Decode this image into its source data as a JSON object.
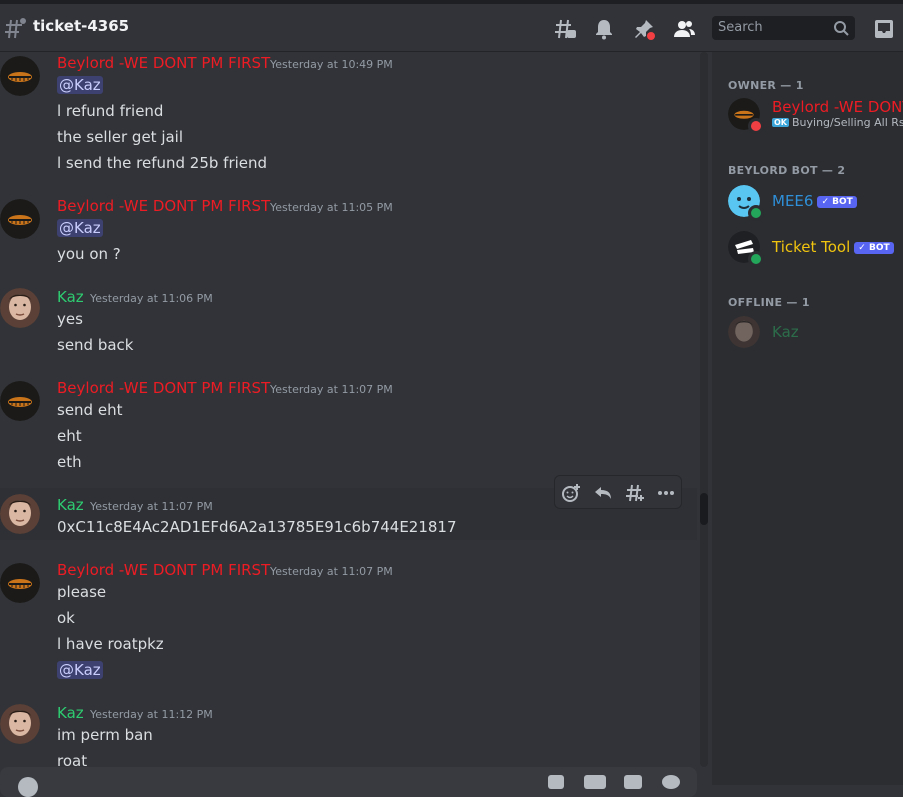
{
  "channel": {
    "name": "ticket-4365"
  },
  "header": {
    "search_placeholder": "Search"
  },
  "messages": [
    {
      "author": "Beylord  -WE DONT PM FIRST",
      "color": "#ed1c24",
      "timestamp": "Yesterday at 10:49 PM",
      "mention": "@Kaz",
      "lines": [
        "l refund friend",
        "the seller get jail",
        "l send the refund 25b friend"
      ]
    },
    {
      "author": "Beylord  -WE DONT PM FIRST",
      "color": "#ed1c24",
      "timestamp": "Yesterday at 11:05 PM",
      "mention": "@Kaz",
      "lines": [
        "you on ?"
      ]
    },
    {
      "author": "Kaz",
      "color": "#2ecc71",
      "timestamp": "Yesterday at 11:06 PM",
      "lines": [
        "yes",
        "send back"
      ]
    },
    {
      "author": "Beylord  -WE DONT PM FIRST",
      "color": "#ed1c24",
      "timestamp": "Yesterday at 11:07 PM",
      "lines": [
        "send eht",
        "eht",
        "eth"
      ]
    },
    {
      "author": "Kaz",
      "color": "#2ecc71",
      "timestamp": "Yesterday at 11:07 PM",
      "lines": [
        "0xC11c8E4Ac2AD1EFd6A2a13785E91c6b744E21817"
      ]
    },
    {
      "author": "Beylord  -WE DONT PM FIRST",
      "color": "#ed1c24",
      "timestamp": "Yesterday at 11:07 PM",
      "lines": [
        "please",
        "ok",
        "l have roatpkz"
      ],
      "mention": "@Kaz"
    },
    {
      "author": "Kaz",
      "color": "#2ecc71",
      "timestamp": "Yesterday at 11:12 PM",
      "lines": [
        "im perm ban",
        "roat"
      ]
    }
  ],
  "members": {
    "owner_title": "OWNER — 1",
    "owner": {
      "name": "Beylord -WE DONT PM FIRST",
      "color": "#ed1c24",
      "status_badge": "OK",
      "status": "Buying/Selling All Rsps"
    },
    "bots_title": "BEYLORD BOT — 2",
    "bots": [
      {
        "name": "MEE6",
        "color": "#2f8fd8",
        "badge": "✓ BOT"
      },
      {
        "name": "Ticket Tool",
        "color": "#f1c40f",
        "badge": "✓ BOT"
      }
    ],
    "offline_title": "OFFLINE — 1",
    "offline": [
      {
        "name": "Kaz",
        "color": "#2ecc71"
      }
    ]
  },
  "icons": [
    "channel-hashtag-icon",
    "threads-icon",
    "notification-bell-icon",
    "pin-icon",
    "member-list-icon",
    "search-icon",
    "inbox-icon",
    "add-reaction-icon",
    "reply-icon",
    "create-thread-icon",
    "more-options-icon"
  ],
  "colors": {
    "background": "#313338",
    "sidebar": "#2b2d31",
    "beylord": "#ed1c24",
    "kaz": "#2ecc71",
    "mention_bg": "#414775"
  }
}
